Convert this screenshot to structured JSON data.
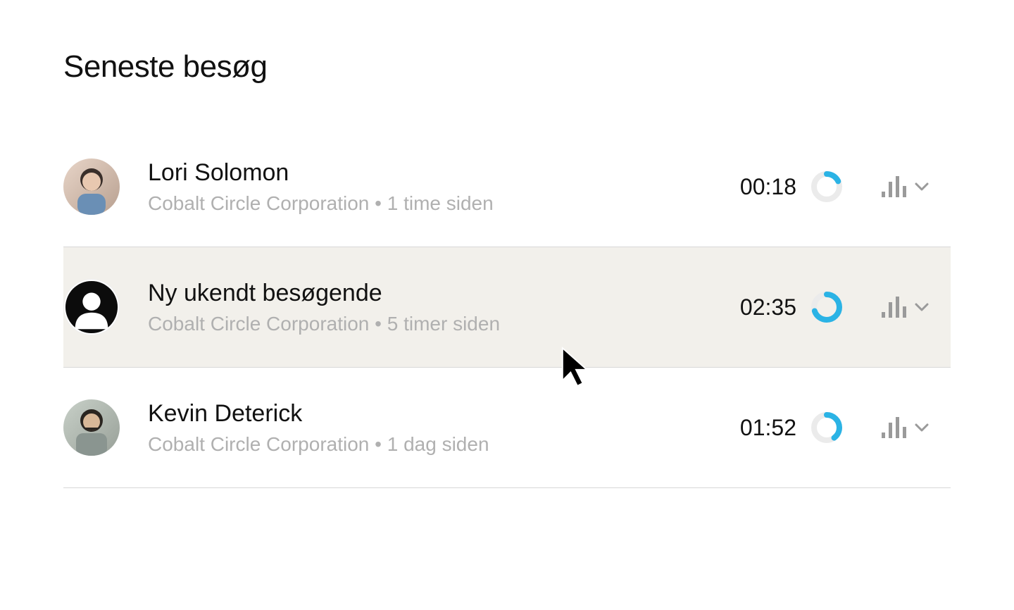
{
  "title": "Seneste besøg",
  "colors": {
    "accent": "#2bb3e5",
    "ringTrack": "#ebebeb",
    "text": "#111111",
    "muted": "#b0b0b0",
    "iconGray": "#9a9a9a"
  },
  "visits": [
    {
      "name": "Lori Solomon",
      "company": "Cobalt Circle Corporation",
      "time_ago": "1 time siden",
      "duration": "00:18",
      "ring_percent": 18,
      "avatar_type": "photo-1",
      "hovered": false
    },
    {
      "name": "Ny ukendt besøgende",
      "company": "Cobalt Circle Corporation",
      "time_ago": "5 timer siden",
      "duration": "02:35",
      "ring_percent": 70,
      "avatar_type": "anon",
      "hovered": true
    },
    {
      "name": "Kevin Deterick",
      "company": "Cobalt Circle Corporation",
      "time_ago": "1 dag siden",
      "duration": "01:52",
      "ring_percent": 40,
      "avatar_type": "photo-3",
      "hovered": false
    }
  ]
}
